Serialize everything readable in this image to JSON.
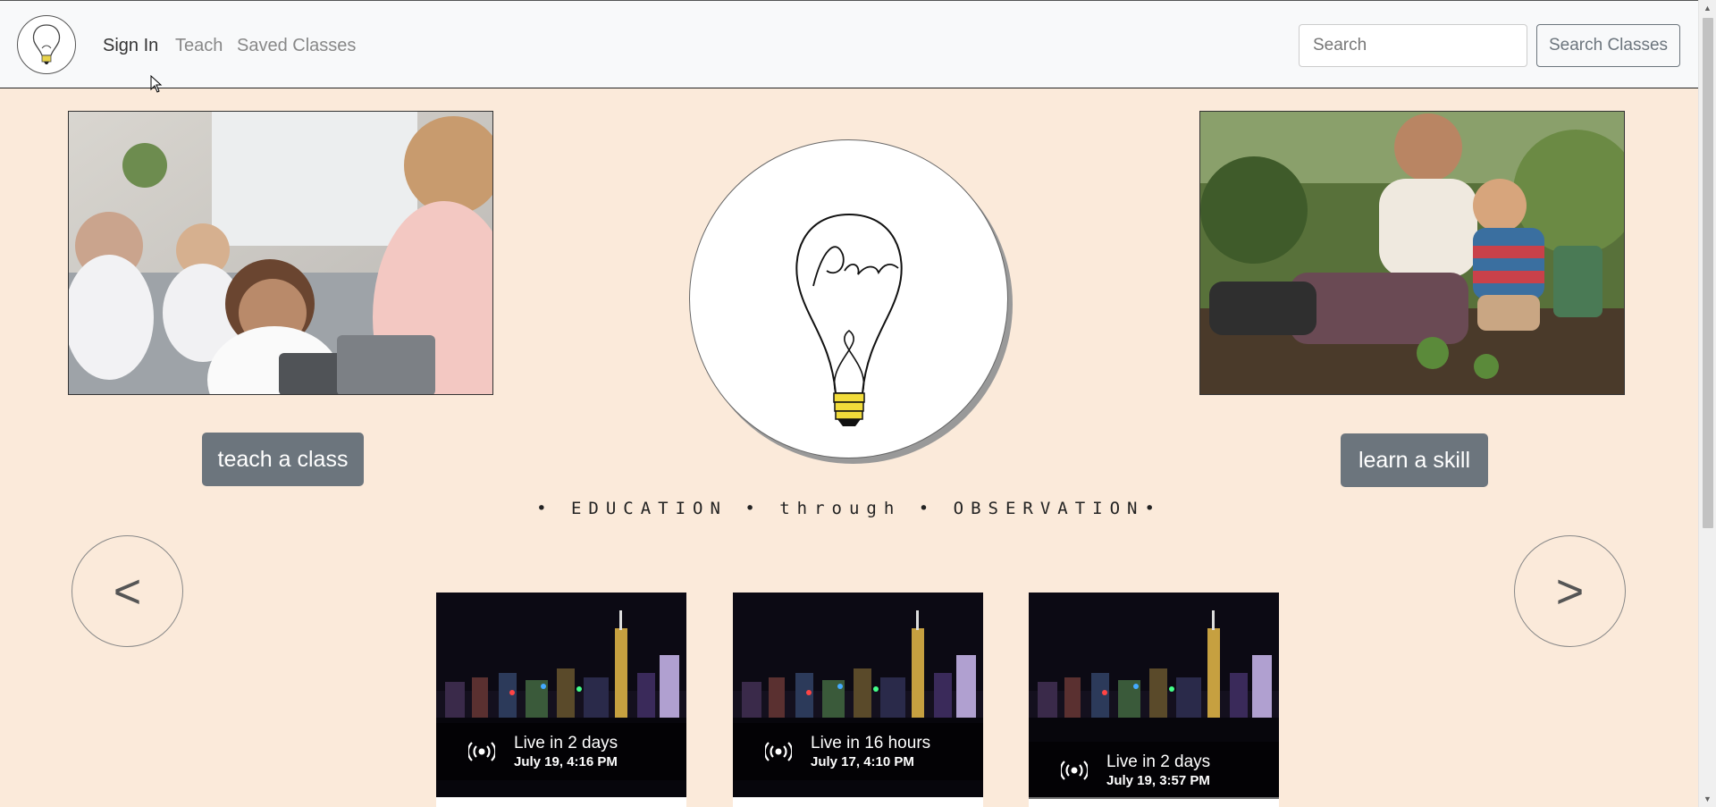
{
  "navbar": {
    "brand_logo": "lightbulb-logo-icon",
    "links": [
      {
        "label": "Sign In"
      },
      {
        "label": "Teach"
      },
      {
        "label": "Saved Classes"
      }
    ],
    "search_placeholder": "Search",
    "search_button_label": "Search Classes"
  },
  "hero": {
    "left_photo": "classroom-students-with-tablets-photo",
    "right_photo": "father-son-gardening-photo",
    "center_logo": "savan-lightbulb-logo",
    "teach_button_label": "teach a class",
    "learn_button_label": "learn a skill",
    "tagline": "• EDUCATION • through • OBSERVATION•"
  },
  "carousel": {
    "prev_label": "<",
    "next_label": ">",
    "cards": [
      {
        "status": "Live in 2 days",
        "date": "July 19, 4:16 PM",
        "icon": "broadcast-icon"
      },
      {
        "status": "Live in 16 hours",
        "date": "July 17, 4:10 PM",
        "icon": "broadcast-icon"
      },
      {
        "status": "Live in 2 days",
        "date": "July 19, 3:57 PM",
        "icon": "broadcast-icon"
      }
    ]
  },
  "colors": {
    "page_background": "#fbeada",
    "button_gray": "#6c757d",
    "navbar_background": "#f8f9fa"
  }
}
